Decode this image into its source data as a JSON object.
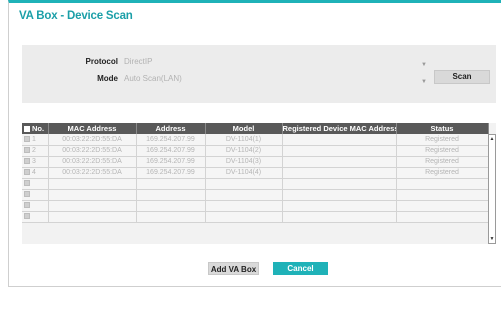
{
  "window": {
    "title": "VA Box - Device Scan"
  },
  "form": {
    "protocol_label": "Protocol",
    "protocol_value": "DirectIP",
    "mode_label": "Mode",
    "mode_value": "Auto Scan(LAN)",
    "scan_label": "Scan"
  },
  "table": {
    "columns": [
      "No.",
      "MAC Address",
      "Address",
      "Model",
      "Registered Device MAC Address",
      "Status"
    ],
    "rows": [
      {
        "no": "1",
        "mac": "00:03:22:2D:55:DA",
        "address": "169.254.207.99",
        "model": "DV-1104(1)",
        "registered_mac": "",
        "status": "Registered"
      },
      {
        "no": "2",
        "mac": "00:03:22:2D:55:DA",
        "address": "169.254.207.99",
        "model": "DV-1104(2)",
        "registered_mac": "",
        "status": "Registered"
      },
      {
        "no": "3",
        "mac": "00:03:22:2D:55:DA",
        "address": "169.254.207.99",
        "model": "DV-1104(3)",
        "registered_mac": "",
        "status": "Registered"
      },
      {
        "no": "4",
        "mac": "00:03:22:2D:55:DA",
        "address": "169.254.207.99",
        "model": "DV-1104(4)",
        "registered_mac": "",
        "status": "Registered"
      },
      {
        "no": "",
        "mac": "",
        "address": "",
        "model": "",
        "registered_mac": "",
        "status": ""
      },
      {
        "no": "",
        "mac": "",
        "address": "",
        "model": "",
        "registered_mac": "",
        "status": ""
      },
      {
        "no": "",
        "mac": "",
        "address": "",
        "model": "",
        "registered_mac": "",
        "status": ""
      },
      {
        "no": "",
        "mac": "",
        "address": "",
        "model": "",
        "registered_mac": "",
        "status": ""
      }
    ]
  },
  "actions": {
    "add_label": "Add VA Box",
    "cancel_label": "Cancel"
  },
  "colors": {
    "accent": "#1fb2b8",
    "title": "#1b9fa8",
    "header_bg": "#595959"
  }
}
